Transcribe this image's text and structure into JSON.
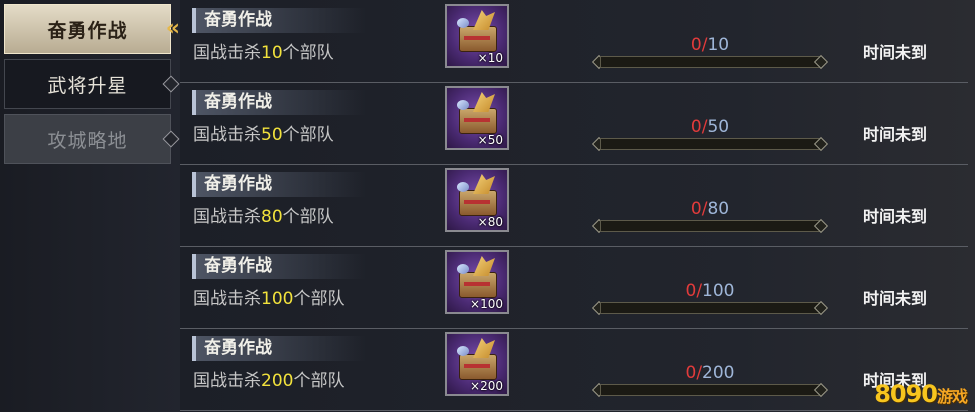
{
  "sidebar": {
    "tabs": [
      {
        "label": "奋勇作战",
        "state": "active"
      },
      {
        "label": "武将升星",
        "state": "normal"
      },
      {
        "label": "攻城略地",
        "state": "disabled"
      }
    ]
  },
  "tasks": [
    {
      "title": "奋勇作战",
      "desc_prefix": "国战击杀",
      "desc_num": "10",
      "desc_suffix": "个部队",
      "reward_icon": "treasure-chest-icon",
      "reward_qty": "×10",
      "progress_current": "0",
      "progress_sep": "/",
      "progress_total": "10",
      "progress_fraction": 0,
      "status": "时间未到"
    },
    {
      "title": "奋勇作战",
      "desc_prefix": "国战击杀",
      "desc_num": "50",
      "desc_suffix": "个部队",
      "reward_icon": "treasure-chest-icon",
      "reward_qty": "×50",
      "progress_current": "0",
      "progress_sep": "/",
      "progress_total": "50",
      "progress_fraction": 0,
      "status": "时间未到"
    },
    {
      "title": "奋勇作战",
      "desc_prefix": "国战击杀",
      "desc_num": "80",
      "desc_suffix": "个部队",
      "reward_icon": "treasure-chest-icon",
      "reward_qty": "×80",
      "progress_current": "0",
      "progress_sep": "/",
      "progress_total": "80",
      "progress_fraction": 0,
      "status": "时间未到"
    },
    {
      "title": "奋勇作战",
      "desc_prefix": "国战击杀",
      "desc_num": "100",
      "desc_suffix": "个部队",
      "reward_icon": "treasure-chest-icon",
      "reward_qty": "×100",
      "progress_current": "0",
      "progress_sep": "/",
      "progress_total": "100",
      "progress_fraction": 0,
      "status": "时间未到"
    },
    {
      "title": "奋勇作战",
      "desc_prefix": "国战击杀",
      "desc_num": "200",
      "desc_suffix": "个部队",
      "reward_icon": "treasure-chest-icon",
      "reward_qty": "×200",
      "progress_current": "0",
      "progress_sep": "/",
      "progress_total": "200",
      "progress_fraction": 0,
      "status": "时间未到"
    }
  ],
  "watermark": {
    "brand": "8090",
    "suffix": "游戏"
  },
  "colors": {
    "highlight_number": "#f2e23c",
    "progress_current": "#e23b3b",
    "progress_total": "#9fb6d8",
    "active_tab": "#e4dcc7"
  }
}
